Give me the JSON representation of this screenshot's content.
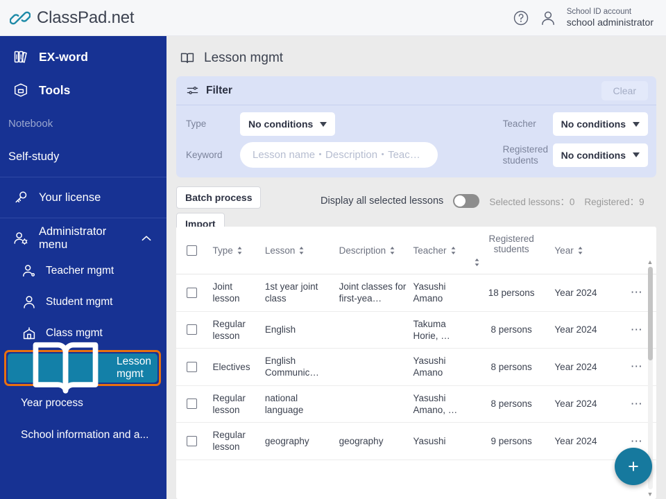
{
  "topbar": {
    "brand": "ClassPad.net",
    "help_icon": "question-circle-icon",
    "user_icon": "user-icon",
    "account_label": "School ID account",
    "account_name": "school administrator"
  },
  "sidebar": {
    "items": [
      {
        "label": "EX-word",
        "icon": "books-icon"
      },
      {
        "label": "Tools",
        "icon": "box-icon"
      },
      {
        "label": "Notebook",
        "icon": "none"
      },
      {
        "label": "Self-study",
        "icon": "none"
      },
      {
        "label": "Your license",
        "icon": "key-icon"
      },
      {
        "label": "Administrator menu",
        "icon": "user-gear-icon",
        "chevron": "chevron-up-icon"
      },
      {
        "label": "Teacher mgmt",
        "icon": "teacher-icon"
      },
      {
        "label": "Student mgmt",
        "icon": "student-icon"
      },
      {
        "label": "Class mgmt",
        "icon": "class-icon"
      },
      {
        "label": "Lesson mgmt",
        "icon": "book-open-icon",
        "active": true
      },
      {
        "label": "Year process",
        "icon": "none"
      },
      {
        "label": "School information and a...",
        "icon": "none"
      }
    ]
  },
  "page": {
    "title": "Lesson mgmt",
    "title_icon": "book-open-icon"
  },
  "filter": {
    "title": "Filter",
    "icon": "sliders-icon",
    "clear_label": "Clear",
    "type_label": "Type",
    "type_value": "No conditions",
    "keyword_label": "Keyword",
    "keyword_value": "",
    "keyword_placeholder": "Lesson name・Description・Teac…",
    "teacher_label": "Teacher",
    "teacher_value": "No conditions",
    "registered_label": "Registered students",
    "registered_value": "No conditions"
  },
  "toolbar": {
    "batch_label": "Batch process",
    "import_label": "Import",
    "toggle_label": "Display all selected lessons",
    "toggle_on": false,
    "selected_lessons": "Selected lessons：0",
    "registered": "Registered：9"
  },
  "table": {
    "columns": [
      {
        "label": "Type",
        "sortable": true
      },
      {
        "label": "Lesson",
        "sortable": true
      },
      {
        "label": "Description",
        "sortable": true
      },
      {
        "label": "Teacher",
        "sortable": true
      },
      {
        "label": "Registered students",
        "sortable": true
      },
      {
        "label": "Year",
        "sortable": true
      }
    ],
    "rows": [
      {
        "type": "Joint lesson",
        "lesson": "1st year joint class",
        "description": "Joint classes for first-yea…",
        "teacher": "Yasushi Amano",
        "registered": "18 persons",
        "year": "Year 2024",
        "menu": "⋯"
      },
      {
        "type": "Regular lesson",
        "lesson": "English",
        "description": "",
        "teacher": "Takuma Horie, …",
        "registered": "8 persons",
        "year": "Year 2024",
        "menu": "⋯"
      },
      {
        "type": "Electives",
        "lesson": "English Communic…",
        "description": "",
        "teacher": "Yasushi Amano",
        "registered": "8 persons",
        "year": "Year 2024",
        "menu": "⋯"
      },
      {
        "type": "Regular lesson",
        "lesson": "national language",
        "description": "",
        "teacher": "Yasushi Amano, …",
        "registered": "8 persons",
        "year": "Year 2024",
        "menu": "⋯"
      },
      {
        "type": "Regular lesson",
        "lesson": "geography",
        "description": "geography",
        "teacher": "Yasushi",
        "registered": "9 persons",
        "year": "Year 2024",
        "menu": "⋯"
      }
    ]
  },
  "fab": {
    "label": "+",
    "icon": "plus-icon"
  },
  "colors": {
    "sidebar": "#173293",
    "active_item": "#1380a8",
    "focus_ring": "#e8700f",
    "filter_panel": "#dbe2f7",
    "fab": "#16799e",
    "brand_accent": "#1f8ba8"
  }
}
